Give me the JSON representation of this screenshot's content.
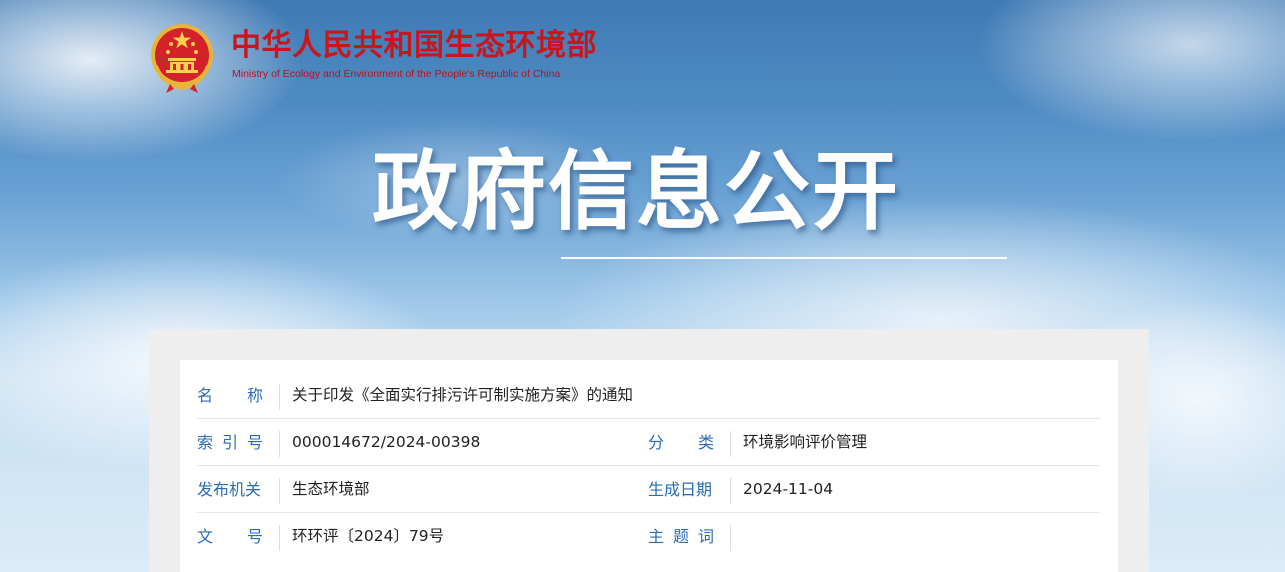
{
  "header": {
    "ministry_name_cn": "中华人民共和国生态环境部",
    "ministry_name_en": "Ministry of Ecology and Environment of the People's Republic of China",
    "emblem_icon": "national-emblem-icon"
  },
  "banner": {
    "title": "政府信息公开"
  },
  "colors": {
    "ministry_red": "#c8161d",
    "label_blue": "#2b6cb5",
    "sky_blue": "#4f8bc3"
  },
  "info": {
    "name_label": [
      "名",
      "称"
    ],
    "name_value": "关于印发《全面实行排污许可制实施方案》的通知",
    "index_label": [
      "索",
      "引",
      "号"
    ],
    "index_value": "000014672/2024-00398",
    "category_label": [
      "分",
      "类"
    ],
    "category_value": "环境影响评价管理",
    "publisher_label": [
      "发布机关"
    ],
    "publisher_value": "生态环境部",
    "date_label": [
      "生成日期"
    ],
    "date_value": "2024-11-04",
    "docno_label": [
      "文",
      "号"
    ],
    "docno_value": "环环评〔2024〕79号",
    "subject_label": [
      "主",
      "题",
      "词"
    ],
    "subject_value": ""
  }
}
